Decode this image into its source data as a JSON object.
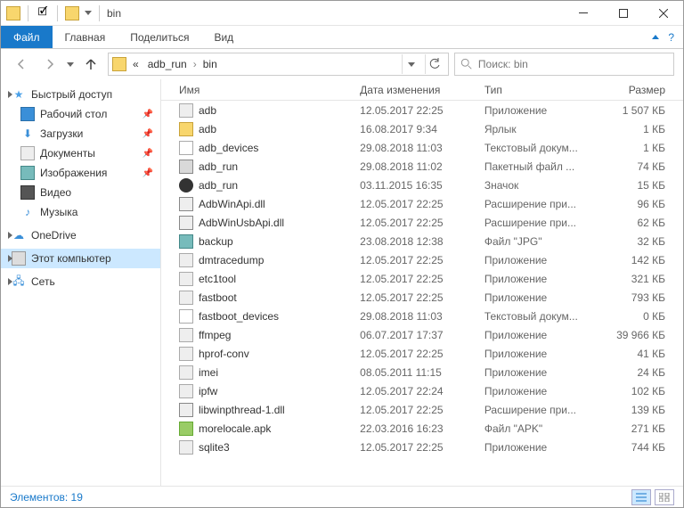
{
  "title": "bin",
  "ribbon": {
    "file": "Файл",
    "home": "Главная",
    "share": "Поделиться",
    "view": "Вид"
  },
  "address": {
    "prefix": "«",
    "crumb1": "adb_run",
    "crumb2": "bin"
  },
  "search": {
    "placeholder": "Поиск: bin"
  },
  "sidebar": {
    "quick": "Быстрый доступ",
    "desktop": "Рабочий стол",
    "downloads": "Загрузки",
    "documents": "Документы",
    "pictures": "Изображения",
    "video": "Видео",
    "music": "Музыка",
    "onedrive": "OneDrive",
    "thispc": "Этот компьютер",
    "network": "Сеть"
  },
  "cols": {
    "name": "Имя",
    "date": "Дата изменения",
    "type": "Тип",
    "size": "Размер"
  },
  "files": [
    {
      "icon": "app",
      "name": "adb",
      "date": "12.05.2017 22:25",
      "type": "Приложение",
      "size": "1 507 КБ"
    },
    {
      "icon": "lnk",
      "name": "adb",
      "date": "16.08.2017 9:34",
      "type": "Ярлык",
      "size": "1 КБ"
    },
    {
      "icon": "txt",
      "name": "adb_devices",
      "date": "29.08.2018 11:03",
      "type": "Текстовый докум...",
      "size": "1 КБ"
    },
    {
      "icon": "bat",
      "name": "adb_run",
      "date": "29.08.2018 11:02",
      "type": "Пакетный файл ...",
      "size": "74 КБ"
    },
    {
      "icon": "ico",
      "name": "adb_run",
      "date": "03.11.2015 16:35",
      "type": "Значок",
      "size": "15 КБ"
    },
    {
      "icon": "dll",
      "name": "AdbWinApi.dll",
      "date": "12.05.2017 22:25",
      "type": "Расширение при...",
      "size": "96 КБ"
    },
    {
      "icon": "dll",
      "name": "AdbWinUsbApi.dll",
      "date": "12.05.2017 22:25",
      "type": "Расширение при...",
      "size": "62 КБ"
    },
    {
      "icon": "jpg",
      "name": "backup",
      "date": "23.08.2018 12:38",
      "type": "Файл \"JPG\"",
      "size": "32 КБ"
    },
    {
      "icon": "app",
      "name": "dmtracedump",
      "date": "12.05.2017 22:25",
      "type": "Приложение",
      "size": "142 КБ"
    },
    {
      "icon": "app",
      "name": "etc1tool",
      "date": "12.05.2017 22:25",
      "type": "Приложение",
      "size": "321 КБ"
    },
    {
      "icon": "app",
      "name": "fastboot",
      "date": "12.05.2017 22:25",
      "type": "Приложение",
      "size": "793 КБ"
    },
    {
      "icon": "txt",
      "name": "fastboot_devices",
      "date": "29.08.2018 11:03",
      "type": "Текстовый докум...",
      "size": "0 КБ"
    },
    {
      "icon": "app",
      "name": "ffmpeg",
      "date": "06.07.2017 17:37",
      "type": "Приложение",
      "size": "39 966 КБ"
    },
    {
      "icon": "app",
      "name": "hprof-conv",
      "date": "12.05.2017 22:25",
      "type": "Приложение",
      "size": "41 КБ"
    },
    {
      "icon": "app",
      "name": "imei",
      "date": "08.05.2011 11:15",
      "type": "Приложение",
      "size": "24 КБ"
    },
    {
      "icon": "app",
      "name": "ipfw",
      "date": "12.05.2017 22:24",
      "type": "Приложение",
      "size": "102 КБ"
    },
    {
      "icon": "dll",
      "name": "libwinpthread-1.dll",
      "date": "12.05.2017 22:25",
      "type": "Расширение при...",
      "size": "139 КБ"
    },
    {
      "icon": "apk",
      "name": "morelocale.apk",
      "date": "22.03.2016 16:23",
      "type": "Файл \"APK\"",
      "size": "271 КБ"
    },
    {
      "icon": "app",
      "name": "sqlite3",
      "date": "12.05.2017 22:25",
      "type": "Приложение",
      "size": "744 КБ"
    }
  ],
  "status": {
    "items": "Элементов: 19"
  }
}
